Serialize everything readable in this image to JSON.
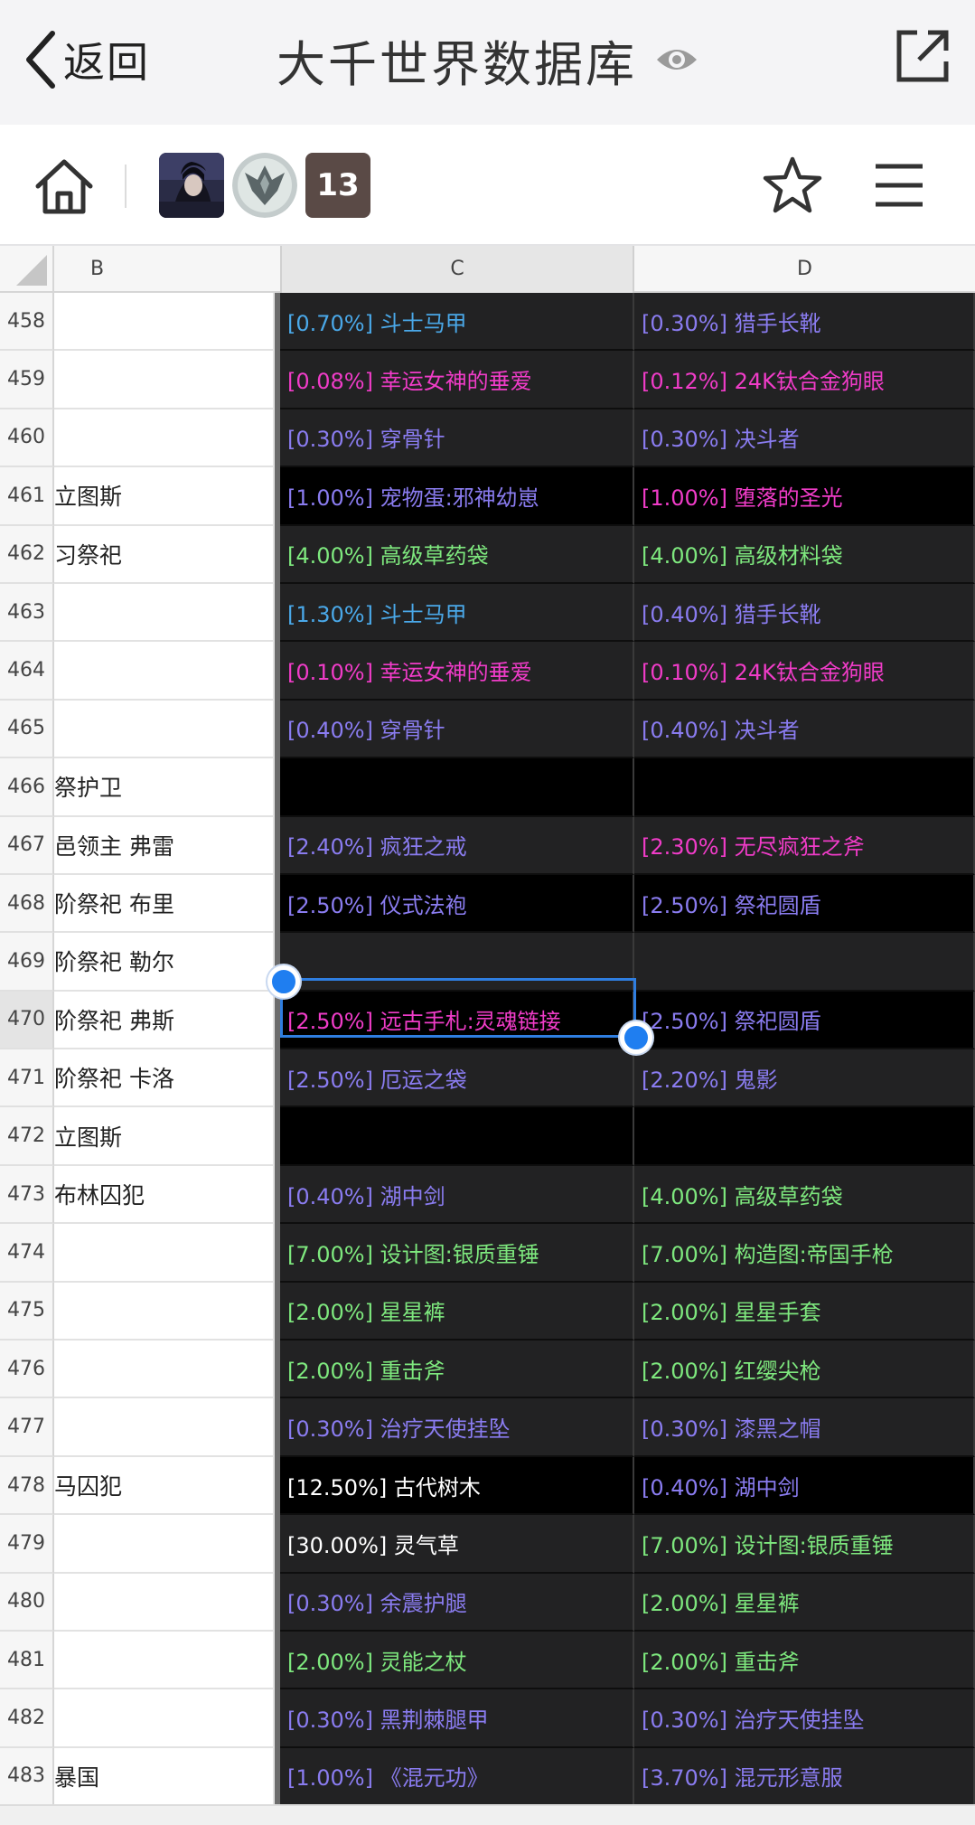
{
  "nav": {
    "back_label": "返回",
    "title": "大千世界数据库"
  },
  "toolbar": {
    "collaborator_count": "13"
  },
  "sheet": {
    "columns": [
      "B",
      "C",
      "D"
    ],
    "rows": [
      {
        "num": "458",
        "b": "",
        "c": "[0.70%] 斗士马甲",
        "c_color": "#4aa8e8",
        "c_bg": "dark",
        "d": "[0.30%] 猎手长靴",
        "d_color": "#8a7cf0",
        "d_bg": "dark"
      },
      {
        "num": "459",
        "b": "",
        "c": "[0.08%] 幸运女神的垂爱",
        "c_color": "#f03cc8",
        "c_bg": "dark",
        "d": "[0.12%] 24K钛合金狗眼",
        "d_color": "#f03cc8",
        "d_bg": "dark"
      },
      {
        "num": "460",
        "b": "",
        "c": "[0.30%] 穿骨针",
        "c_color": "#8a7cf0",
        "c_bg": "dark",
        "d": "[0.30%] 决斗者",
        "d_color": "#8a7cf0",
        "d_bg": "dark"
      },
      {
        "num": "461",
        "b": "立图斯",
        "c": "[1.00%] 宠物蛋:邪神幼崽",
        "c_color": "#8a7cf0",
        "c_bg": "black",
        "d": "[1.00%] 堕落的圣光",
        "d_color": "#f03cc8",
        "d_bg": "black"
      },
      {
        "num": "462",
        "b": "习祭祀",
        "c": "[4.00%] 高级草药袋",
        "c_color": "#7ee87e",
        "c_bg": "dark",
        "d": "[4.00%] 高级材料袋",
        "d_color": "#7ee87e",
        "d_bg": "dark"
      },
      {
        "num": "463",
        "b": "",
        "c": "[1.30%] 斗士马甲",
        "c_color": "#4aa8e8",
        "c_bg": "dark",
        "d": "[0.40%] 猎手长靴",
        "d_color": "#8a7cf0",
        "d_bg": "dark"
      },
      {
        "num": "464",
        "b": "",
        "c": "[0.10%] 幸运女神的垂爱",
        "c_color": "#f03cc8",
        "c_bg": "dark",
        "d": "[0.10%] 24K钛合金狗眼",
        "d_color": "#f03cc8",
        "d_bg": "dark"
      },
      {
        "num": "465",
        "b": "",
        "c": "[0.40%] 穿骨针",
        "c_color": "#8a7cf0",
        "c_bg": "dark",
        "d": "[0.40%] 决斗者",
        "d_color": "#8a7cf0",
        "d_bg": "dark"
      },
      {
        "num": "466",
        "b": "祭护卫",
        "c": "",
        "c_color": "#ffffff",
        "c_bg": "black",
        "d": "",
        "d_color": "#ffffff",
        "d_bg": "black"
      },
      {
        "num": "467",
        "b": "邑领主 弗雷",
        "c": "[2.40%] 疯狂之戒",
        "c_color": "#8a7cf0",
        "c_bg": "dark",
        "d": "[2.30%] 无尽疯狂之斧",
        "d_color": "#f03cc8",
        "d_bg": "dark"
      },
      {
        "num": "468",
        "b": "阶祭祀 布里",
        "c": "[2.50%] 仪式法袍",
        "c_color": "#8a7cf0",
        "c_bg": "black",
        "d": "[2.50%] 祭祀圆盾",
        "d_color": "#8a7cf0",
        "d_bg": "black"
      },
      {
        "num": "469",
        "b": "阶祭祀 勒尔",
        "c": "",
        "c_color": "#ffffff",
        "c_bg": "dark",
        "d": "",
        "d_color": "#ffffff",
        "d_bg": "dark"
      },
      {
        "num": "470",
        "b": "阶祭祀 弗斯",
        "c": "[2.50%] 远古手札:灵魂链接",
        "c_color": "#f03cc8",
        "c_bg": "black",
        "d": "[2.50%] 祭祀圆盾",
        "d_color": "#8a7cf0",
        "d_bg": "black"
      },
      {
        "num": "471",
        "b": "阶祭祀 卡洛",
        "c": "[2.50%] 厄运之袋",
        "c_color": "#8a7cf0",
        "c_bg": "dark",
        "d": "[2.20%] 鬼影",
        "d_color": "#8a7cf0",
        "d_bg": "dark"
      },
      {
        "num": "472",
        "b": "立图斯",
        "c": "",
        "c_color": "#ffffff",
        "c_bg": "black",
        "d": "",
        "d_color": "#ffffff",
        "d_bg": "black"
      },
      {
        "num": "473",
        "b": "布林囚犯",
        "c": "[0.40%] 湖中剑",
        "c_color": "#8a7cf0",
        "c_bg": "dark",
        "d": "[4.00%] 高级草药袋",
        "d_color": "#7ee87e",
        "d_bg": "dark"
      },
      {
        "num": "474",
        "b": "",
        "c": "[7.00%] 设计图:银质重锤",
        "c_color": "#7ee87e",
        "c_bg": "dark",
        "d": "[7.00%] 构造图:帝国手枪",
        "d_color": "#7ee87e",
        "d_bg": "dark"
      },
      {
        "num": "475",
        "b": "",
        "c": "[2.00%] 星星裤",
        "c_color": "#7ee87e",
        "c_bg": "dark",
        "d": "[2.00%] 星星手套",
        "d_color": "#7ee87e",
        "d_bg": "dark"
      },
      {
        "num": "476",
        "b": "",
        "c": "[2.00%] 重击斧",
        "c_color": "#7ee87e",
        "c_bg": "dark",
        "d": "[2.00%] 红缨尖枪",
        "d_color": "#7ee87e",
        "d_bg": "dark"
      },
      {
        "num": "477",
        "b": "",
        "c": "[0.30%] 治疗天使挂坠",
        "c_color": "#8a7cf0",
        "c_bg": "dark",
        "d": "[0.30%] 漆黑之帽",
        "d_color": "#8a7cf0",
        "d_bg": "dark"
      },
      {
        "num": "478",
        "b": "马囚犯",
        "c": "[12.50%] 古代树木",
        "c_color": "#ffffff",
        "c_bg": "black",
        "d": "[0.40%] 湖中剑",
        "d_color": "#8a7cf0",
        "d_bg": "black"
      },
      {
        "num": "479",
        "b": "",
        "c": "[30.00%] 灵气草",
        "c_color": "#ffffff",
        "c_bg": "dark",
        "d": "[7.00%] 设计图:银质重锤",
        "d_color": "#7ee87e",
        "d_bg": "dark"
      },
      {
        "num": "480",
        "b": "",
        "c": "[0.30%] 余震护腿",
        "c_color": "#8a7cf0",
        "c_bg": "dark",
        "d": "[2.00%] 星星裤",
        "d_color": "#7ee87e",
        "d_bg": "dark"
      },
      {
        "num": "481",
        "b": "",
        "c": "[2.00%] 灵能之杖",
        "c_color": "#7ee87e",
        "c_bg": "dark",
        "d": "[2.00%] 重击斧",
        "d_color": "#7ee87e",
        "d_bg": "dark"
      },
      {
        "num": "482",
        "b": "",
        "c": "[0.30%] 黑荆棘腿甲",
        "c_color": "#8a7cf0",
        "c_bg": "dark",
        "d": "[0.30%] 治疗天使挂坠",
        "d_color": "#8a7cf0",
        "d_bg": "dark"
      },
      {
        "num": "483",
        "b": "暴国",
        "c": "[1.00%] 《混元功》",
        "c_color": "#8a7cf0",
        "c_bg": "dark",
        "d": "[3.70%] 混元形意服",
        "d_color": "#8a7cf0",
        "d_bg": "dark"
      }
    ]
  }
}
